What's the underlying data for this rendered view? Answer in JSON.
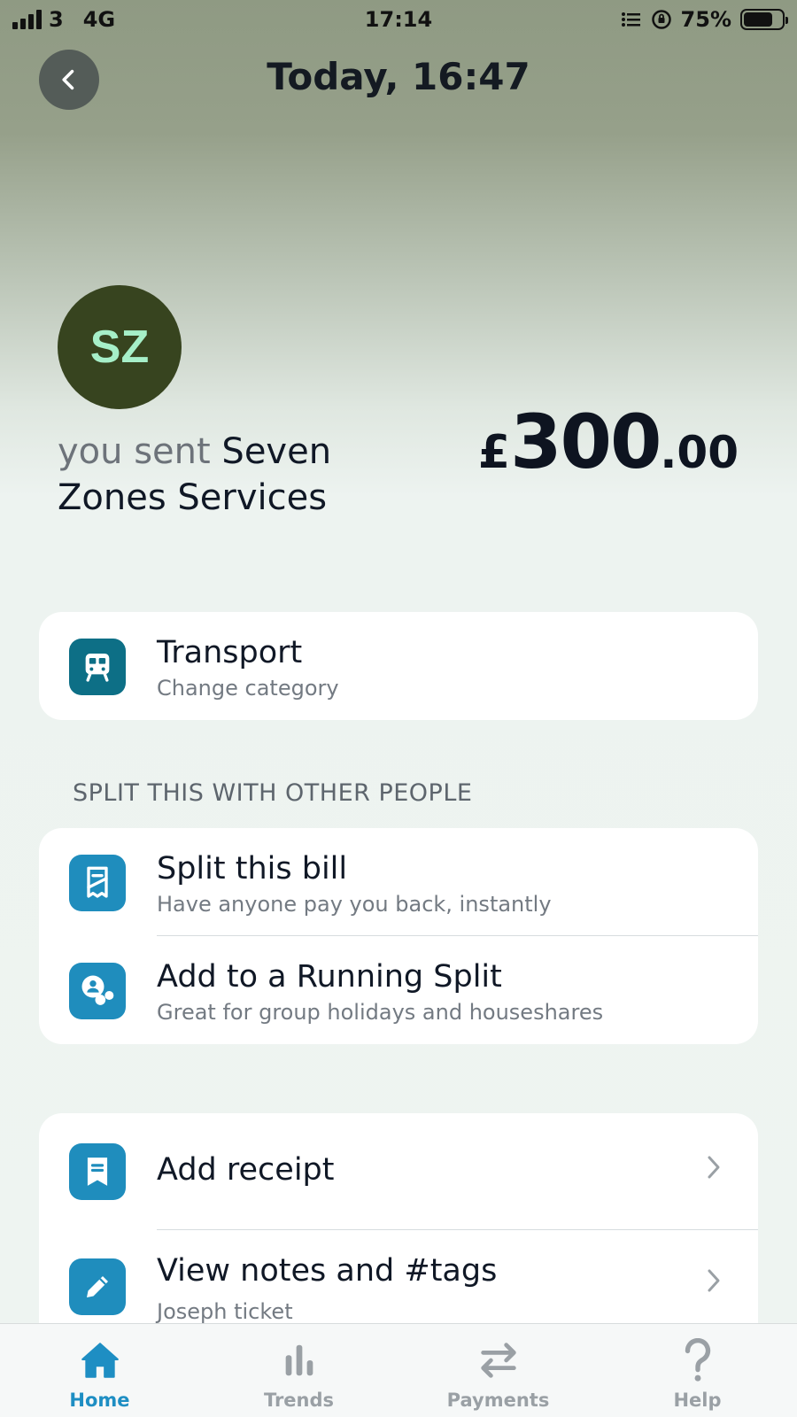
{
  "status_bar": {
    "carrier": "3",
    "network": "4G",
    "time": "17:14",
    "battery_percent": "75%",
    "battery_level": 0.75
  },
  "header": {
    "title": "Today, 16:47",
    "back_icon": "chevron-left-icon"
  },
  "transaction": {
    "avatar_initials": "SZ",
    "avatar_color": "#37441f",
    "avatar_text_color": "#a6efc8",
    "direction_label": "you sent",
    "merchant": "Seven Zones Services",
    "amount": {
      "currency": "£",
      "major": "300",
      "minor": ".00"
    }
  },
  "category": {
    "title": "Transport",
    "subtitle": "Change category",
    "icon": "train-icon",
    "icon_color": "#0d6f86"
  },
  "split_section": {
    "label": "SPLIT THIS WITH OTHER PEOPLE",
    "items": [
      {
        "title": "Split this bill",
        "subtitle": "Have anyone pay you back, instantly",
        "icon": "receipt-split-icon"
      },
      {
        "title": "Add to a Running Split",
        "subtitle": "Great for group holidays and houseshares",
        "icon": "group-icon"
      }
    ]
  },
  "actions": {
    "items": [
      {
        "title": "Add receipt",
        "icon": "receipt-icon"
      },
      {
        "title": "View notes and #tags",
        "subtitle": "Joseph ticket",
        "icon": "pencil-icon"
      }
    ]
  },
  "tab_bar": {
    "active": "Home",
    "tabs": [
      {
        "label": "Home",
        "icon": "home-icon"
      },
      {
        "label": "Trends",
        "icon": "bar-chart-icon"
      },
      {
        "label": "Payments",
        "icon": "transfer-arrows-icon"
      },
      {
        "label": "Help",
        "icon": "question-icon"
      }
    ]
  },
  "colors": {
    "accent": "#1e8ec3",
    "icon_blue": "#1f8dbd"
  }
}
